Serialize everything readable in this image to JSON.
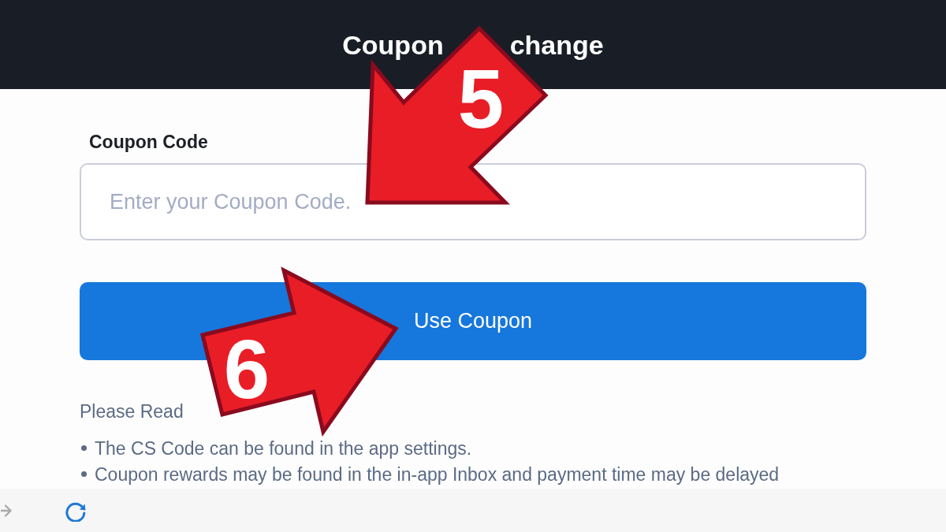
{
  "header": {
    "title_fragments": [
      "Coupon",
      "change"
    ]
  },
  "form": {
    "label": "Coupon Code",
    "input": {
      "placeholder": "Enter your Coupon Code."
    },
    "button": "Use Coupon"
  },
  "notice": {
    "heading": "Please Read",
    "items": [
      "The CS Code can be found in the app settings.",
      "Coupon rewards may be found in the in-app Inbox and payment time may be delayed"
    ]
  },
  "annotations": [
    {
      "kind": "southwest",
      "label": "5"
    },
    {
      "kind": "east",
      "label": "6"
    }
  ]
}
